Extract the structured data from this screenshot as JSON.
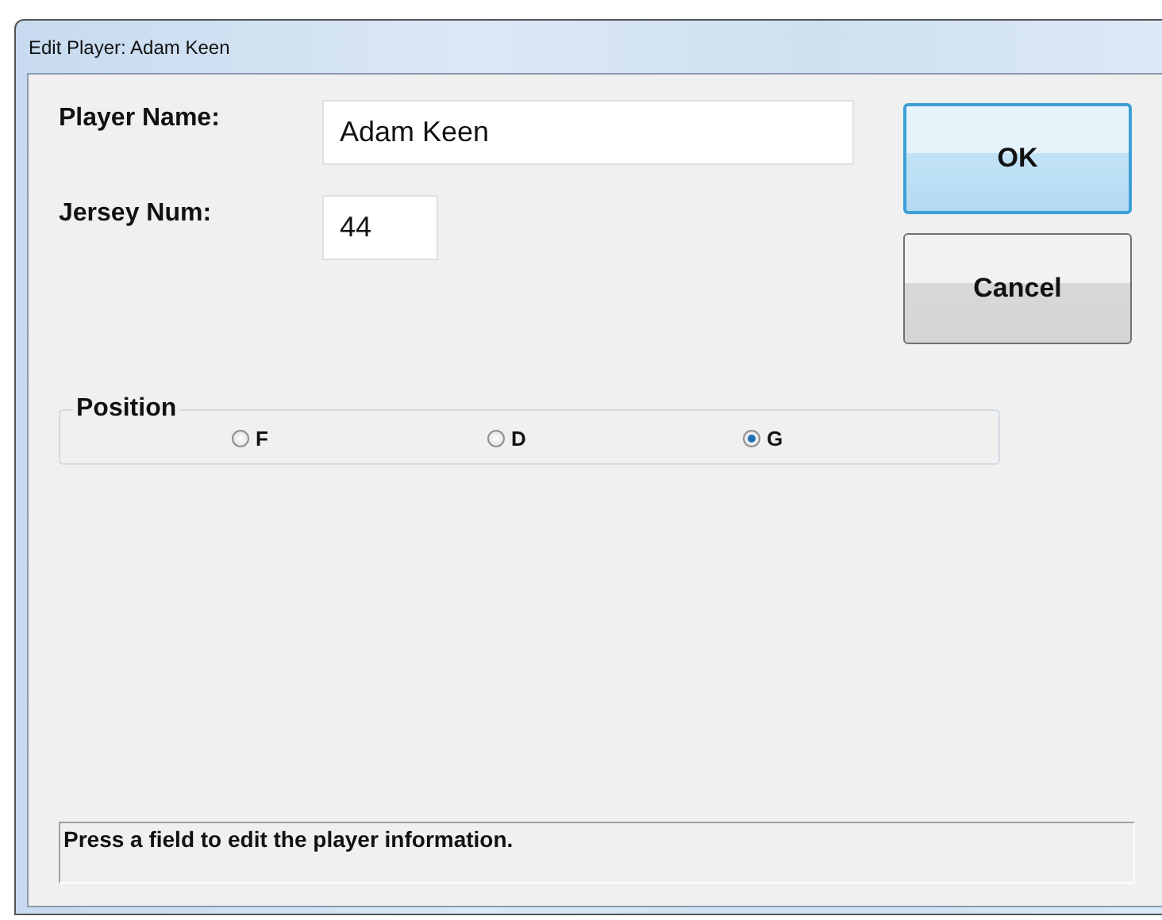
{
  "window": {
    "title": "Edit Player: Adam Keen"
  },
  "fields": [
    {
      "label": "Player Name:",
      "value": "Adam Keen"
    },
    {
      "label": "Jersey Num:",
      "value": "44"
    }
  ],
  "buttons": [
    {
      "label": "OK",
      "default": true
    },
    {
      "label": "Cancel",
      "default": false
    }
  ],
  "position": {
    "legend": "Position",
    "options": [
      {
        "label": "F",
        "selected": false
      },
      {
        "label": "D",
        "selected": false
      },
      {
        "label": "G",
        "selected": true
      }
    ]
  },
  "status_bar": "Press a field to edit the player information."
}
